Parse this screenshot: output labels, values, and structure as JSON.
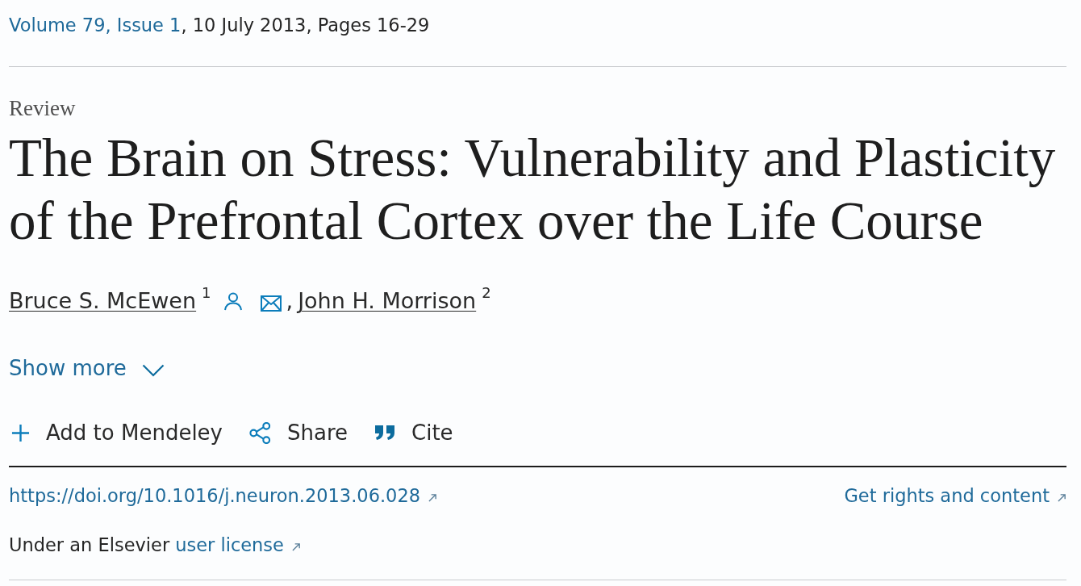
{
  "citation": {
    "volume_issue": "Volume 79, Issue 1",
    "details": ", 10 July 2013, Pages 16-29"
  },
  "article": {
    "type": "Review",
    "title": "The Brain on Stress: Vulnerability and Plasticity of the Prefrontal Cortex over the Life Course",
    "authors": [
      {
        "name": "Bruce S. McEwen",
        "affiliation": "1",
        "profile_icon": true,
        "email_icon": true,
        "separator": ","
      },
      {
        "name": "John H. Morrison",
        "affiliation": "2",
        "profile_icon": false,
        "email_icon": false
      }
    ],
    "show_more": {
      "label": "Show more",
      "expanded": false
    }
  },
  "actions": [
    {
      "kind": "add",
      "label": "Add to Mendeley"
    },
    {
      "kind": "share",
      "label": "Share"
    },
    {
      "kind": "cite",
      "label": "Cite"
    }
  ],
  "links": {
    "doi": "https://doi.org/10.1016/j.neuron.2013.06.028",
    "rights": "Get rights and content"
  },
  "license": {
    "text": "Under an Elsevier",
    "link": "user license"
  }
}
